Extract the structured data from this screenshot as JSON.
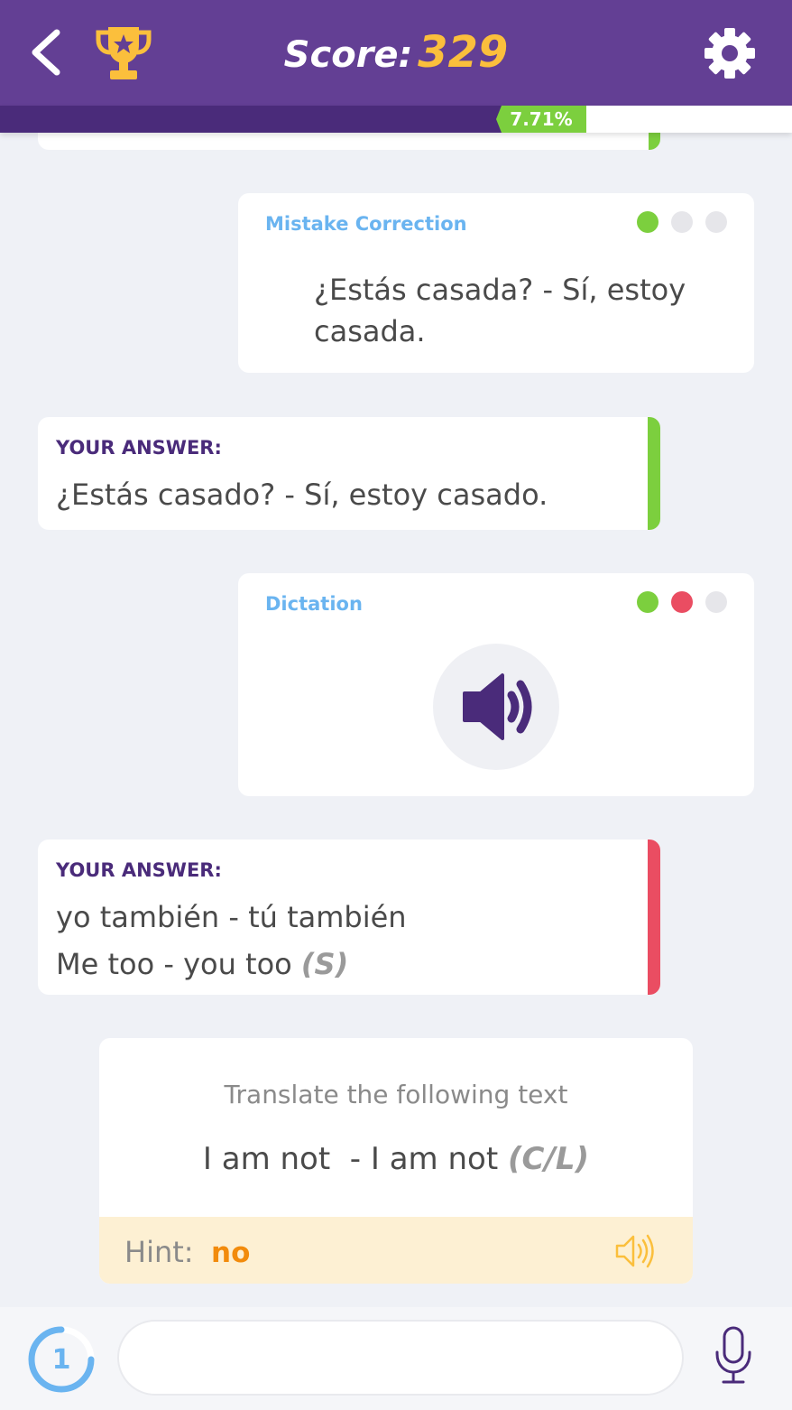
{
  "header": {
    "score_label": "Score:",
    "score_value": "329",
    "progress_text": "7.71%",
    "progress_fraction": 0.0771
  },
  "colors": {
    "header_bg": "#633f94",
    "progress_fill": "#4a2b7a",
    "score_accent": "#fbbf3c",
    "correct_green": "#7ccf3e",
    "wrong_red": "#ea4d62",
    "exercise_type": "#6ab4f0",
    "hint_value": "#f28b0c"
  },
  "icons": {
    "back": "chevron-left-icon",
    "trophy": "trophy-icon",
    "settings": "gear-icon",
    "speaker": "speaker-icon",
    "hint_audio": "speaker-outline-icon",
    "microphone": "microphone-icon"
  },
  "mistake_card": {
    "type": "Mistake Correction",
    "dots": [
      "green",
      "gray",
      "gray"
    ],
    "text": "¿Estás casada? - Sí, estoy casada."
  },
  "answer1": {
    "label": "YOUR ANSWER:",
    "line1": "¿Estás casado? - Sí, estoy casado.",
    "status": "correct"
  },
  "dictation_card": {
    "type": "Dictation",
    "dots": [
      "green",
      "red",
      "gray"
    ]
  },
  "answer2": {
    "label": "YOUR ANSWER:",
    "line1": "yo también - tú también",
    "line2": "Me too - you too",
    "line2_tag": "(S)",
    "status": "wrong"
  },
  "translate_card": {
    "instruction": "Translate the following text",
    "prompt": "I am not  - I am not",
    "prompt_tag": "(C/L)",
    "hint_label": "Hint:",
    "hint_value": "no"
  },
  "footer": {
    "counter": "1",
    "input_value": "",
    "input_placeholder": ""
  }
}
